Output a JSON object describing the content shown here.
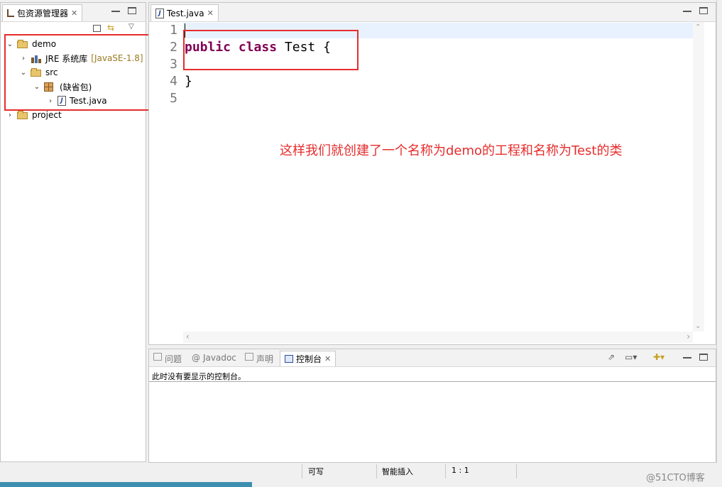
{
  "package_explorer": {
    "tab_label": "包资源管理器",
    "tree": {
      "demo": "demo",
      "jre": "JRE 系统库",
      "jre_version": "[JavaSE-1.8]",
      "src": "src",
      "default_pkg": "(缺省包)",
      "test_file": "Test.java",
      "project": "project"
    }
  },
  "editor": {
    "tab_label": "Test.java",
    "line_numbers": [
      "1",
      "2",
      "3",
      "4",
      "5"
    ],
    "code": {
      "kw_public": "public",
      "kw_class": "class",
      "class_name": "Test {",
      "close_brace": "}"
    },
    "annotation": "这样我们就创建了一个名称为demo的工程和名称为Test的类"
  },
  "bottom_panel": {
    "tabs": {
      "problems": "问题",
      "javadoc": "Javadoc",
      "declaration": "声明",
      "console": "控制台"
    },
    "console_message": "此时没有要显示的控制台。"
  },
  "status_bar": {
    "writable": "可写",
    "insert_mode": "智能插入",
    "position": "1 : 1"
  },
  "watermark": "@51CTO博客",
  "colors": {
    "keyword": "#7f0055",
    "annotation": "#e62d2d",
    "current_line": "#e8f2fe"
  }
}
